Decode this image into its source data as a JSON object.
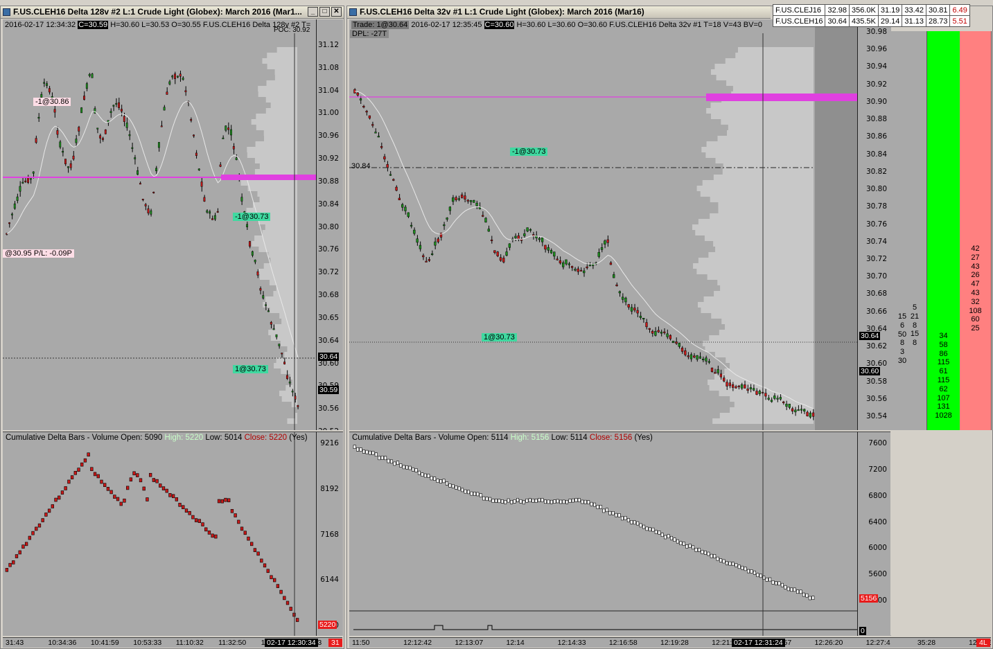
{
  "left_window": {
    "title": "F.US.CLEH16  Delta 128v  #2  L:1  Crude Light (Globex): March 2016 (Mar1...",
    "info": {
      "datetime": "2016-02-17 12:34:32",
      "close": "C=30.59",
      "rest": "H=30.60 L=30.53 O=30.55 F.US.CLEH16  Delta 128v  #2 T="
    },
    "poc": "POC: 30.92",
    "price_ticks": [
      "31.12",
      "31.08",
      "31.04",
      "31.00",
      "30.96",
      "30.92",
      "30.88",
      "30.84",
      "30.80",
      "30.76",
      "30.72",
      "30.68",
      "30.65",
      "30.64",
      "30.60",
      "30.59",
      "30.56",
      "30.52"
    ],
    "last_price": "30.64",
    "close_price": "30.59",
    "labels": {
      "sell1": "-1@30.86",
      "sell2": "-1@30.73",
      "buy1": "1@30.73",
      "pl": "@30.95 P/L: -0.09P"
    },
    "cum": {
      "header": "Cumulative Delta Bars - Volume  Open: 5090",
      "high": "High: 5220",
      "low": "Low: 5014",
      "close": "Close: 5220",
      "yes": "(Yes)",
      "ticks": [
        "9216",
        "8192",
        "7168",
        "6144",
        "5120"
      ],
      "last": "5220"
    },
    "time_ticks": [
      "31:43",
      "10:34:36",
      "10:41:59",
      "10:53:33",
      "11:10:32",
      "11:32:50",
      "12:02:12",
      "12:13"
    ],
    "time_cursor": "02-17  12:30:34",
    "time_red": "31"
  },
  "right_window": {
    "title": "F.US.CLEH16  Delta 32v  #1  L:1  Crude Light (Globex): March 2016 (Mar16)",
    "info": {
      "trade": "Trade: 1@30.64",
      "datetime": "2016-02-17 12:35:45",
      "close": "C=30.60",
      "rest": "H=30.60 L=30.60 O=30.60 F.US.CLEH16  Delta 32v  #1 T=18 V=43 BV=0",
      "dpl": "DPL: -27T"
    },
    "price_ticks": [
      "30.98",
      "30.96",
      "30.94",
      "30.92",
      "30.90",
      "30.88",
      "30.86",
      "30.84",
      "30.82",
      "30.80",
      "30.78",
      "30.76",
      "30.74",
      "30.72",
      "30.70",
      "30.68",
      "30.66",
      "30.64",
      "30.62",
      "30.60",
      "30.58",
      "30.56",
      "30.54"
    ],
    "last_price": "30.64",
    "close_price": "30.60",
    "level_label": "30.84",
    "labels": {
      "sell": "-1@30.73",
      "buy": "1@30.73"
    },
    "cum": {
      "header": "Cumulative Delta Bars - Volume  Open: 5114",
      "high": "High: 5156",
      "low": "Low: 5114",
      "close": "Close: 5156",
      "yes": "(Yes)",
      "ticks": [
        "7600",
        "7200",
        "6800",
        "6400",
        "6000",
        "5600",
        "5200"
      ],
      "last": "5156",
      "zero": "0"
    },
    "time_ticks": [
      "11:50",
      "12:12:42",
      "12:13:07",
      "12:14",
      "12:14:33",
      "12:16:58",
      "12:19:28",
      "12:21:40",
      "12:23:57",
      "12:26:20",
      "12:27:4",
      "35:28",
      "12:37:53"
    ],
    "time_cursor": "02-17  12:31:24",
    "time_red": "4L"
  },
  "quotes": [
    {
      "symbol": "F.US.CLEJ16",
      "last": "32.98",
      "vol": "356.0K",
      "low": "31.19",
      "high": "33.42",
      "open": "30.81",
      "chg": "6.49"
    },
    {
      "symbol": "F.US.CLEH16",
      "last": "30.64",
      "vol": "435.5K",
      "low": "29.14",
      "high": "31.13",
      "open": "28.73",
      "chg": "5.51"
    }
  ],
  "dom": {
    "bid_col1": [
      "15",
      "6",
      "50",
      "8",
      "3",
      "30"
    ],
    "bid_col2": [
      "5",
      "21",
      "8",
      "15",
      "8"
    ],
    "green": [
      "34",
      "58",
      "86",
      "115",
      "61",
      "115",
      "62",
      "107",
      "131",
      "1028"
    ],
    "red": [
      "42",
      "27",
      "43",
      "26",
      "47",
      "43",
      "32",
      "108",
      "60",
      "25"
    ]
  },
  "colors": {
    "up": "#1d8f1d",
    "down": "#c81818",
    "magenta": "#e040e0",
    "bid": "#00ff00",
    "ask": "#ff8080",
    "profile": "#c8c8c8"
  }
}
